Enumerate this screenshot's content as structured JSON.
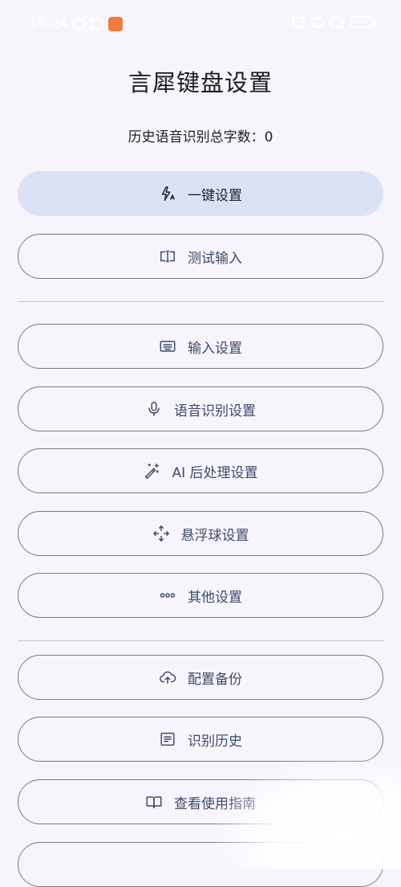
{
  "status_bar": {
    "time": "15:24",
    "icons": [
      "alarm-icon",
      "nfc-icon",
      "signal-icon",
      "app-icon"
    ]
  },
  "page": {
    "title": "言犀键盘设置",
    "subtitle": "历史语音识别总字数：0"
  },
  "buttons": {
    "quick_setup": "一键设置",
    "test_input": "测试输入",
    "input_settings": "输入设置",
    "asr_settings": "语音识别设置",
    "ai_postprocess": "AI 后处理设置",
    "floating_ball": "悬浮球设置",
    "other_settings": "其他设置",
    "backup": "配置备份",
    "history": "识别历史",
    "guide": "查看使用指南"
  },
  "colors": {
    "background": "#f7f4fb",
    "primary_button": "#dce2f5",
    "outline": "#7a7a83",
    "label": "#3e4a6a"
  }
}
